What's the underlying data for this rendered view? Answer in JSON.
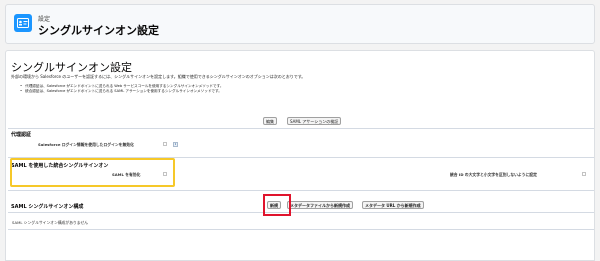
{
  "header": {
    "breadcrumb": "設定",
    "title": "シングルサインオン設定",
    "icon": "id-card-icon"
  },
  "main": {
    "title": "シングルサインオン設定",
    "description": "外部の環境から Salesforce のユーザーを認証するには、シングルサインオンを設定します。組織で使用できるシングルサインオンのオプションは次のとおりです。",
    "bullets": [
      "代理認証は、Salesforce がエンドポイントに送られる Web サービスコールを使用するシングルサインオンメソッドです。",
      "統合認証は、Salesforce がエンドポイントに送られる SAML アサーションを使用するシングルサインオンメソッドです。"
    ],
    "edit_button": "編集",
    "saml_validator_button": "SAML アサーションの検証"
  },
  "delegated": {
    "title": "代理認証",
    "label": "Salesforce ログイン情報を使用したログインを無効化",
    "checked": false
  },
  "saml": {
    "title": "SAML を使用した統合シングルサインオン",
    "enabled_label": "SAML を有効化",
    "enabled_checked": false,
    "case_label": "統合 ID の大文字と小文字を区別しないように設定",
    "case_checked": false
  },
  "config": {
    "title": "SAML シングルサインオン構成",
    "new_button": "新規",
    "from_file_button": "メタデータファイルから新規作成",
    "from_url_button": "メタデータ URL から新規作成",
    "empty_text": "SAML シングルサインオン構成がありません"
  },
  "colors": {
    "accent": "#1b96ff",
    "highlight_yellow": "#f6c829",
    "highlight_red": "#e0142d"
  }
}
